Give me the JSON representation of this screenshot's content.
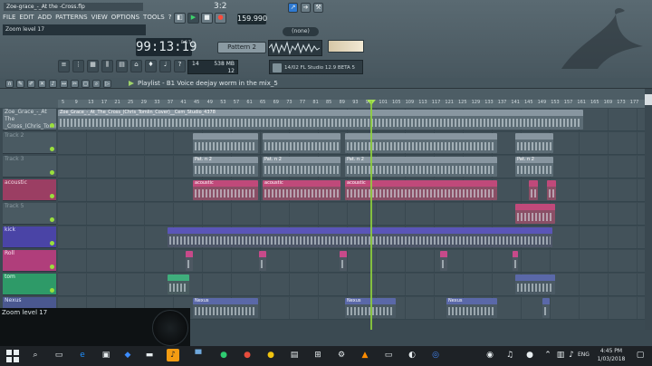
{
  "window": {
    "title": "Zoe-grace_-_At the -Cross.flp"
  },
  "menu": [
    "FILE",
    "EDIT",
    "ADD",
    "PATTERNS",
    "VIEW",
    "OPTIONS",
    "TOOLS",
    "?"
  ],
  "hint_top": "Zoom level 17",
  "transport": {
    "bar_step": "3:2",
    "tempo": "159.990",
    "time": "99:13:19",
    "time_unit": "B:S:T",
    "pattern": "Pattern 2",
    "output": "(none)"
  },
  "cpu": {
    "cpu": "14",
    "mem": "538 MB",
    "voices": "12"
  },
  "version": {
    "date": "14/02",
    "text": "FL Studio 12.9 BETA 5"
  },
  "playlist": {
    "title": "Playlist - B1 Voice deejay worm in the mix_5"
  },
  "ruler_labels": [
    "5",
    "9",
    "13",
    "17",
    "21",
    "25",
    "29",
    "33",
    "37",
    "41",
    "45",
    "49",
    "53",
    "57",
    "61",
    "65",
    "69",
    "73",
    "77",
    "81",
    "85",
    "89",
    "93",
    "97",
    "101",
    "105",
    "109",
    "113",
    "117",
    "121",
    "125",
    "129",
    "133",
    "137",
    "141",
    "145",
    "149",
    "153",
    "157",
    "161",
    "165",
    "169",
    "173",
    "177"
  ],
  "tracks": [
    {
      "label": "Zoe_Grace_-_At The _Cross_(Chris_Tomlin)",
      "color": "#5f6f78",
      "text": "#d5dde1"
    },
    {
      "label": "Track 2",
      "color": "#4a5a62",
      "text": "#8b9aa1"
    },
    {
      "label": "Track 3",
      "color": "#4a5a62",
      "text": "#8b9aa1"
    },
    {
      "label": "acoustic",
      "color": "#9b3e63",
      "text": "#f0d6e1"
    },
    {
      "label": "Track 5",
      "color": "#4a5a62",
      "text": "#8b9aa1"
    },
    {
      "label": "kick",
      "color": "#4a44a6",
      "text": "#e2e0ff"
    },
    {
      "label": "Roll",
      "color": "#b03e7b",
      "text": "#ffe4f2"
    },
    {
      "label": "tom",
      "color": "#2e9a68",
      "text": "#e2ffef"
    },
    {
      "label": "Nexus",
      "color": "#4a5890",
      "text": "#dfe5ff"
    }
  ],
  "audio_clip": "Zoe_Grace_-_At_The_Cross_(Chris_Tomlin_Cover)__Cem_Studio_4378",
  "clip_labels": {
    "pat": "Pat. n 2",
    "acoustic": "acoustic",
    "nexus": "Nexus"
  },
  "hint_bottom": "Zoom level 17",
  "taskbar": {
    "time": "4:45 PM",
    "date": "1/03/2018",
    "lang": "ENG"
  }
}
